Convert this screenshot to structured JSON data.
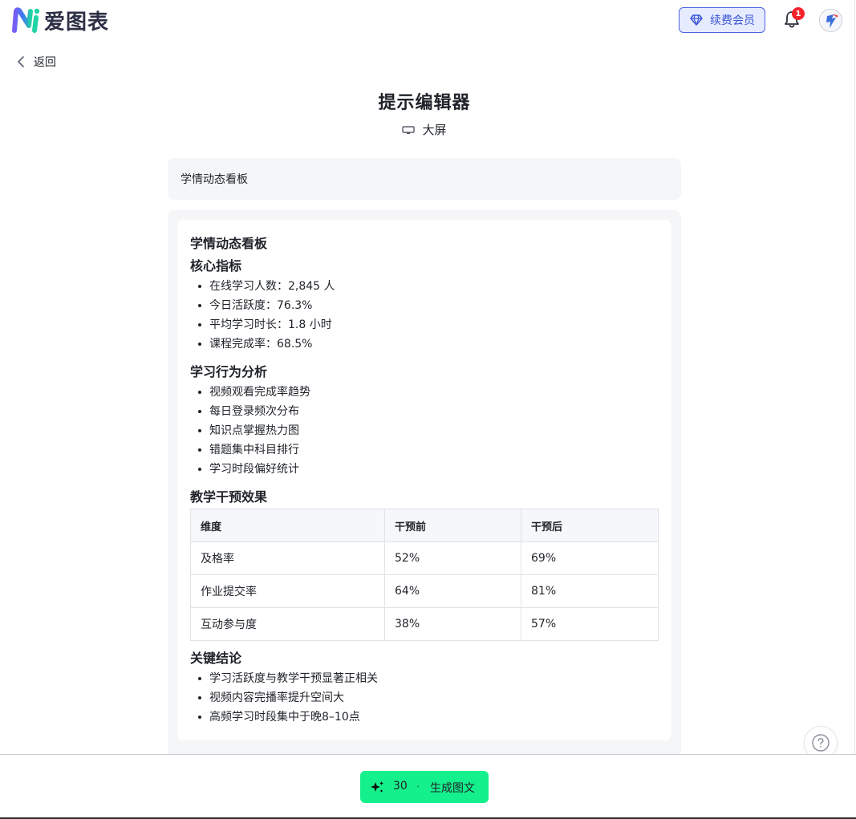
{
  "header": {
    "brand": "爱图表",
    "renew_label": "续费会员",
    "notification_count": "1",
    "accent_color": "#3b56d6",
    "badge_color": "#f5222d"
  },
  "nav": {
    "back_label": "返回"
  },
  "page": {
    "title": "提示编辑器",
    "screen_label": "大屏"
  },
  "prompt": {
    "value": "学情动态看板"
  },
  "content": {
    "heading": "学情动态看板",
    "sections": [
      {
        "title": "核心指标",
        "items": [
          "在线学习人数：2,845 人",
          "今日活跃度：76.3%",
          "平均学习时长：1.8 小时",
          "课程完成率：68.5%"
        ]
      },
      {
        "title": "学习行为分析",
        "items": [
          "视频观看完成率趋势",
          "每日登录频次分布",
          "知识点掌握热力图",
          "错题集中科目排行",
          "学习时段偏好统计"
        ]
      },
      {
        "title": "教学干预效果"
      },
      {
        "title": "关键结论",
        "items": [
          "学习活跃度与教学干预显著正相关",
          "视频内容完播率提升空间大",
          "高频学习时段集中于晚8–10点"
        ]
      }
    ],
    "table": {
      "headers": [
        "维度",
        "干预前",
        "干预后"
      ],
      "rows": [
        [
          "及格率",
          "52%",
          "69%"
        ],
        [
          "作业提交率",
          "64%",
          "81%"
        ],
        [
          "互动参与度",
          "38%",
          "57%"
        ]
      ]
    }
  },
  "footer": {
    "credits": "30",
    "generate_label": "生成图文",
    "button_color": "#14f08c"
  }
}
